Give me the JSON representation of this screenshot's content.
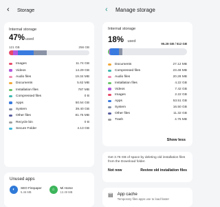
{
  "left": {
    "header": {
      "title": "Storage"
    },
    "storage": {
      "label": "Internal storage",
      "percent": "47%",
      "used_word": "used",
      "used_amount": "121 GB",
      "total_amount": "256 GB"
    },
    "categories": [
      {
        "name": "Images",
        "size": "11.74 GB",
        "color": "#e84a6a"
      },
      {
        "name": "Videos",
        "size": "14.29 GB",
        "color": "#b25ae0"
      },
      {
        "name": "Audio files",
        "size": "19.34 MB",
        "color": "#f08bb0"
      },
      {
        "name": "Documents",
        "size": "5.62 MB",
        "color": "#f2a93b"
      },
      {
        "name": "Installation files",
        "size": "787 MB",
        "color": "#6ac46a"
      },
      {
        "name": "Compressed files",
        "size": "0 B",
        "color": "#3fb8b0"
      },
      {
        "name": "Apps",
        "size": "50.54 GB",
        "color": "#3a7be0"
      },
      {
        "name": "System",
        "size": "39.40 GB",
        "color": "#8a93a6"
      },
      {
        "name": "Other files",
        "size": "81.75 MB",
        "color": "#5a5f9e"
      },
      {
        "name": "Recycle bin",
        "size": "0 B",
        "color": "#a0a0a0"
      },
      {
        "name": "Secure Folder",
        "size": "4.13 GB",
        "color": "#3fb8d8"
      }
    ],
    "unused": {
      "title": "Unused apps",
      "apps": [
        {
          "name": "SEO Firepaper",
          "size": "5.46 MB",
          "color": "#2f7ad8",
          "glyph": "◐"
        },
        {
          "name": "Mi Home",
          "size": "12.49 MB",
          "color": "#3cb55a",
          "glyph": "⌂"
        }
      ]
    }
  },
  "right": {
    "header": {
      "title": "Manage storage"
    },
    "storage": {
      "label": "Internal storage",
      "percent": "18%",
      "used_word": "used",
      "amount": "95.28 GB / 512 GB"
    },
    "categories": [
      {
        "name": "Documents",
        "size": "27.12 MB",
        "color": "#f2a93b"
      },
      {
        "name": "Compressed files",
        "size": "23.48 MB",
        "color": "#3fb8b0"
      },
      {
        "name": "Audio files",
        "size": "20.28 MB",
        "color": "#f08bb0"
      },
      {
        "name": "Installation files",
        "size": "4.22 GB",
        "color": "#6ac46a"
      },
      {
        "name": "Videos",
        "size": "7.42 GB",
        "color": "#b25ae0"
      },
      {
        "name": "Images",
        "size": "2.22 GB",
        "color": "#e84a6a"
      },
      {
        "name": "Apps",
        "size": "53.51 GB",
        "color": "#3a7be0"
      },
      {
        "name": "System",
        "size": "16.50 GB",
        "color": "#8a93a6"
      },
      {
        "name": "Other files",
        "size": "11.32 GB",
        "color": "#5a5f9e"
      },
      {
        "name": "Trash",
        "size": "4.75 MB",
        "color": "#a0a0a0"
      }
    ],
    "show_less": "Show less",
    "tip": {
      "text": "Get 3.76 GB of space by deleting old installation files from the Download folder.",
      "dismiss": "Not now",
      "action": "Review old installation files"
    },
    "cache": {
      "title": "App cache",
      "desc": "Temporary files apps use to load faster"
    }
  }
}
